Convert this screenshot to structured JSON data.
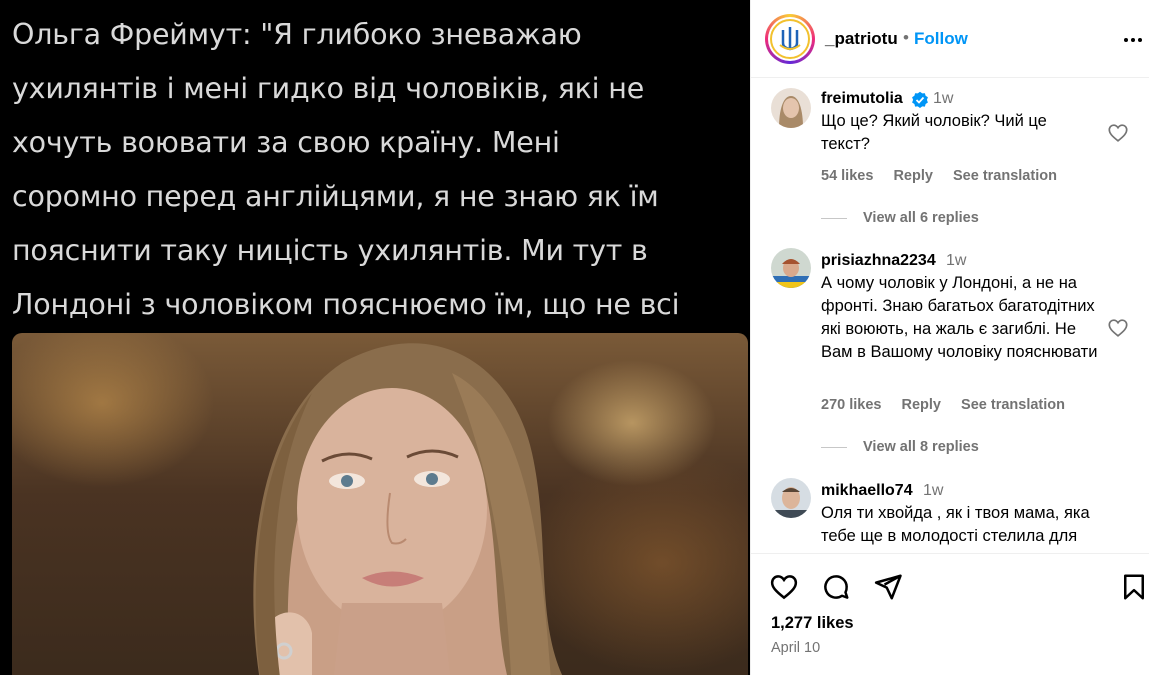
{
  "post": {
    "caption_text": "Ольга Фреймут: \"Я глибоко зневажаю\nухилянтів і мені гидко від чоловіків, які не\nхочуть воювати за свою країну. Мені\nсоромно перед англійцями, я не знаю як їм\nпояснити таку ницість ухилянтів. Ми тут в\nЛондоні з чоловіком пояснюємо їм, що не всі\nчоловіки в Україні такі жалюгідні.\""
  },
  "header": {
    "username": "_patriotu",
    "separator": "•",
    "follow_label": "Follow",
    "more_icon": "more-horizontal-icon"
  },
  "comments": [
    {
      "username": "freimutolia",
      "verified": true,
      "time": "1w",
      "text": "Що це? Який чоловік? Чий це текст?",
      "likes": "54 likes",
      "reply_label": "Reply",
      "translate_label": "See translation",
      "replies_label": "View all 6 replies"
    },
    {
      "username": "prisiazhna2234",
      "verified": false,
      "time": "1w",
      "text": "А чому чоловік у Лондоні, а не на фронті. Знаю багатьох багатодітних які воюють, на жаль є загиблі. Не Вам в Вашому чоловіку пояснювати",
      "likes": "270 likes",
      "reply_label": "Reply",
      "translate_label": "See translation",
      "replies_label": "View all 8 replies"
    },
    {
      "username": "mikhaello74",
      "verified": false,
      "time": "1w",
      "text": "Оля ти хвойда , як і твоя мама, яка тебе ще в молодості стелила для"
    }
  ],
  "actions": {
    "likes": "1,277 likes",
    "date": "April 10",
    "icons": [
      "heart-icon",
      "comment-icon",
      "share-icon",
      "bookmark-icon"
    ]
  },
  "colors": {
    "accent": "#0095f6",
    "muted": "#737373",
    "verified": "#0095f6",
    "media_bg": "#000000",
    "media_text": "#d9d9d9"
  }
}
